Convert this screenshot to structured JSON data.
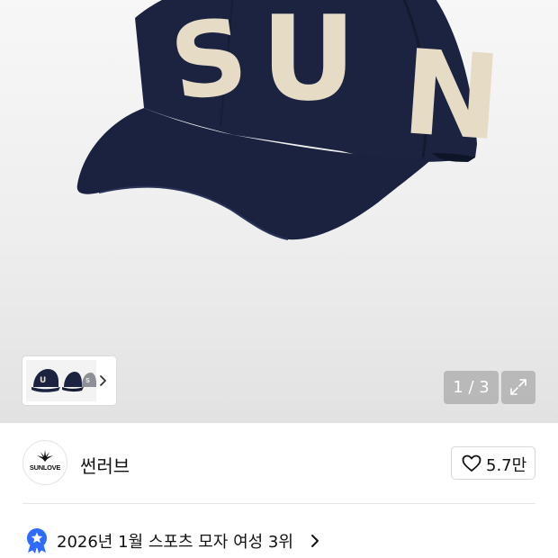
{
  "product_image": {
    "cap_text": [
      "S",
      "U",
      "N"
    ],
    "cap_color": "#1b2340",
    "letter_color": "#e6dcc6"
  },
  "thumbnails": {
    "count_visible": 3,
    "more_icon": "chevron-right-icon"
  },
  "gallery": {
    "counter": "1 / 3",
    "expand_icon": "expand-icon"
  },
  "brand": {
    "logo_text": "SUNLOVE",
    "name": "썬러브"
  },
  "like": {
    "icon": "heart-outline-icon",
    "count": "5.7만"
  },
  "ranking": {
    "badge_icon": "star-medal-icon",
    "badge_color": "#2f6bff",
    "text": "2026년 1월 스포츠 모자 여성 3위",
    "more_icon": "chevron-right-icon"
  }
}
